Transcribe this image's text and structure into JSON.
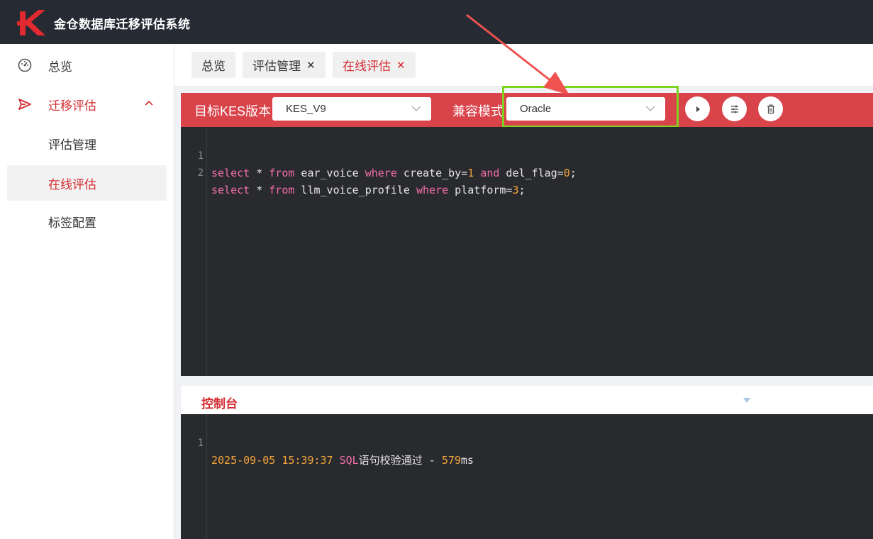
{
  "app": {
    "title": "金仓数据库迁移评估系统"
  },
  "sidebar": {
    "items": [
      {
        "label": "总览",
        "icon": "dashboard-icon"
      },
      {
        "label": "迁移评估",
        "icon": "send-icon",
        "expanded": true,
        "children": [
          {
            "label": "评估管理"
          },
          {
            "label": "在线评估",
            "active": true
          },
          {
            "label": "标签配置"
          }
        ]
      }
    ]
  },
  "tabs": [
    {
      "label": "总览",
      "closable": false
    },
    {
      "label": "评估管理",
      "closable": true,
      "close": "✕"
    },
    {
      "label": "在线评估",
      "closable": true,
      "close": "✕",
      "active": true
    }
  ],
  "toolbar": {
    "version_label": "目标KES版本",
    "version_value": "KES_V9",
    "mode_label": "兼容模式",
    "mode_value": "Oracle",
    "buttons": [
      "play-icon",
      "sliders-icon",
      "trash-icon"
    ]
  },
  "editor": {
    "lines": [
      {
        "n": "1",
        "text": "select * from ear_voice where create_by=1 and del_flag=0;"
      },
      {
        "n": "2",
        "text": "select * from llm_voice_profile where platform=3;"
      }
    ]
  },
  "console": {
    "title": "控制台",
    "lines": [
      {
        "n": "1",
        "time": "2025-09-05 15:39:37",
        "sql": "SQL",
        "msg": "语句校验通过 - ",
        "ms": "579",
        "unit": "ms"
      }
    ]
  },
  "colors": {
    "accent": "#d42b30",
    "toolbar": "#d9434a",
    "topbar": "#262a33",
    "highlight": "#7ed321",
    "editor_bg": "#292a2e"
  }
}
